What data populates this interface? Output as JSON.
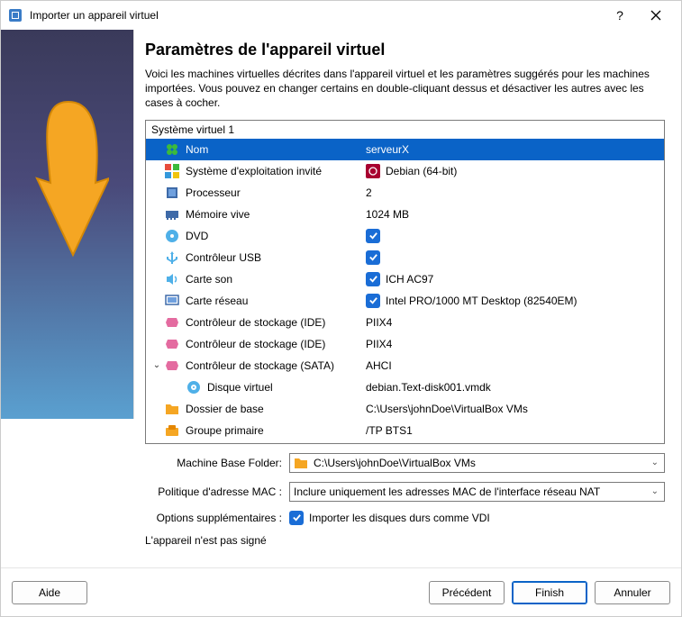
{
  "window": {
    "title": "Importer un appareil virtuel"
  },
  "page": {
    "heading": "Paramètres de l'appareil virtuel",
    "description": "Voici les machines virtuelles décrites dans l'appareil virtuel et les paramètres suggérés pour les machines importées. Vous pouvez en changer certains en double-cliquant dessus et désactiver les autres avec les cases à cocher."
  },
  "tree": {
    "system_header": "Système virtuel 1",
    "rows": {
      "name": {
        "label": "Nom",
        "value": "serveurX"
      },
      "guest_os": {
        "label": "Système d'exploitation invité",
        "value": "Debian (64-bit)"
      },
      "cpu": {
        "label": "Processeur",
        "value": "2"
      },
      "ram": {
        "label": "Mémoire vive",
        "value": "1024 MB"
      },
      "dvd": {
        "label": "DVD"
      },
      "usb": {
        "label": "Contrôleur USB"
      },
      "sound": {
        "label": "Carte son",
        "value": "ICH AC97"
      },
      "net": {
        "label": "Carte réseau",
        "value": "Intel PRO/1000 MT Desktop (82540EM)"
      },
      "ide1": {
        "label": "Contrôleur de stockage (IDE)",
        "value": "PIIX4"
      },
      "ide2": {
        "label": "Contrôleur de stockage (IDE)",
        "value": "PIIX4"
      },
      "sata": {
        "label": "Contrôleur de stockage (SATA)",
        "value": "AHCI"
      },
      "vdisk": {
        "label": "Disque virtuel",
        "value": "debian.Text-disk001.vmdk"
      },
      "basefolder": {
        "label": "Dossier de base",
        "value": "C:\\Users\\johnDoe\\VirtualBox VMs"
      },
      "group": {
        "label": "Groupe primaire",
        "value": "/TP BTS1"
      }
    }
  },
  "form": {
    "base_folder_label": "Machine Base Folder:",
    "base_folder_value": "C:\\Users\\johnDoe\\VirtualBox VMs",
    "mac_label": "Politique d'adresse MAC :",
    "mac_value": "Inclure uniquement les adresses MAC de l'interface réseau NAT",
    "extra_label": "Options supplémentaires :",
    "extra_value": "Importer les disques durs comme VDI",
    "signature_note": "L'appareil n'est pas signé"
  },
  "buttons": {
    "help": "Aide",
    "back": "Précédent",
    "finish": "Finish",
    "cancel": "Annuler"
  }
}
